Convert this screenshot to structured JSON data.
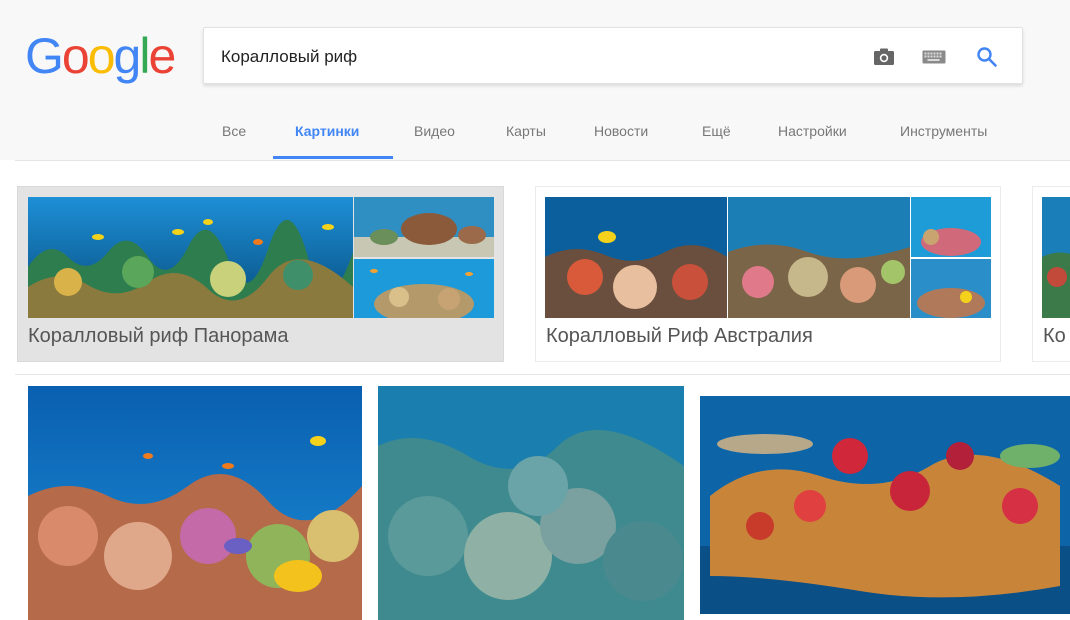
{
  "logo": {
    "letters": [
      "G",
      "o",
      "o",
      "g",
      "l",
      "e"
    ]
  },
  "search": {
    "query": "Коралловый риф"
  },
  "icons": {
    "camera": "camera-icon",
    "keyboard": "keyboard-icon",
    "search": "search-icon"
  },
  "tabs": [
    {
      "label": "Все"
    },
    {
      "label": "Картинки"
    },
    {
      "label": "Видео"
    },
    {
      "label": "Карты"
    },
    {
      "label": "Новости"
    },
    {
      "label": "Ещё"
    },
    {
      "label": "Настройки"
    },
    {
      "label": "Инструменты"
    }
  ],
  "collections": [
    {
      "label": "Коралловый риф Панорама"
    },
    {
      "label": "Коралловый Риф Австралия"
    },
    {
      "label": "Ко"
    }
  ],
  "colors": {
    "accent": "#4285f4",
    "water": "#0a6fb0",
    "deep_water": "#04365e"
  }
}
